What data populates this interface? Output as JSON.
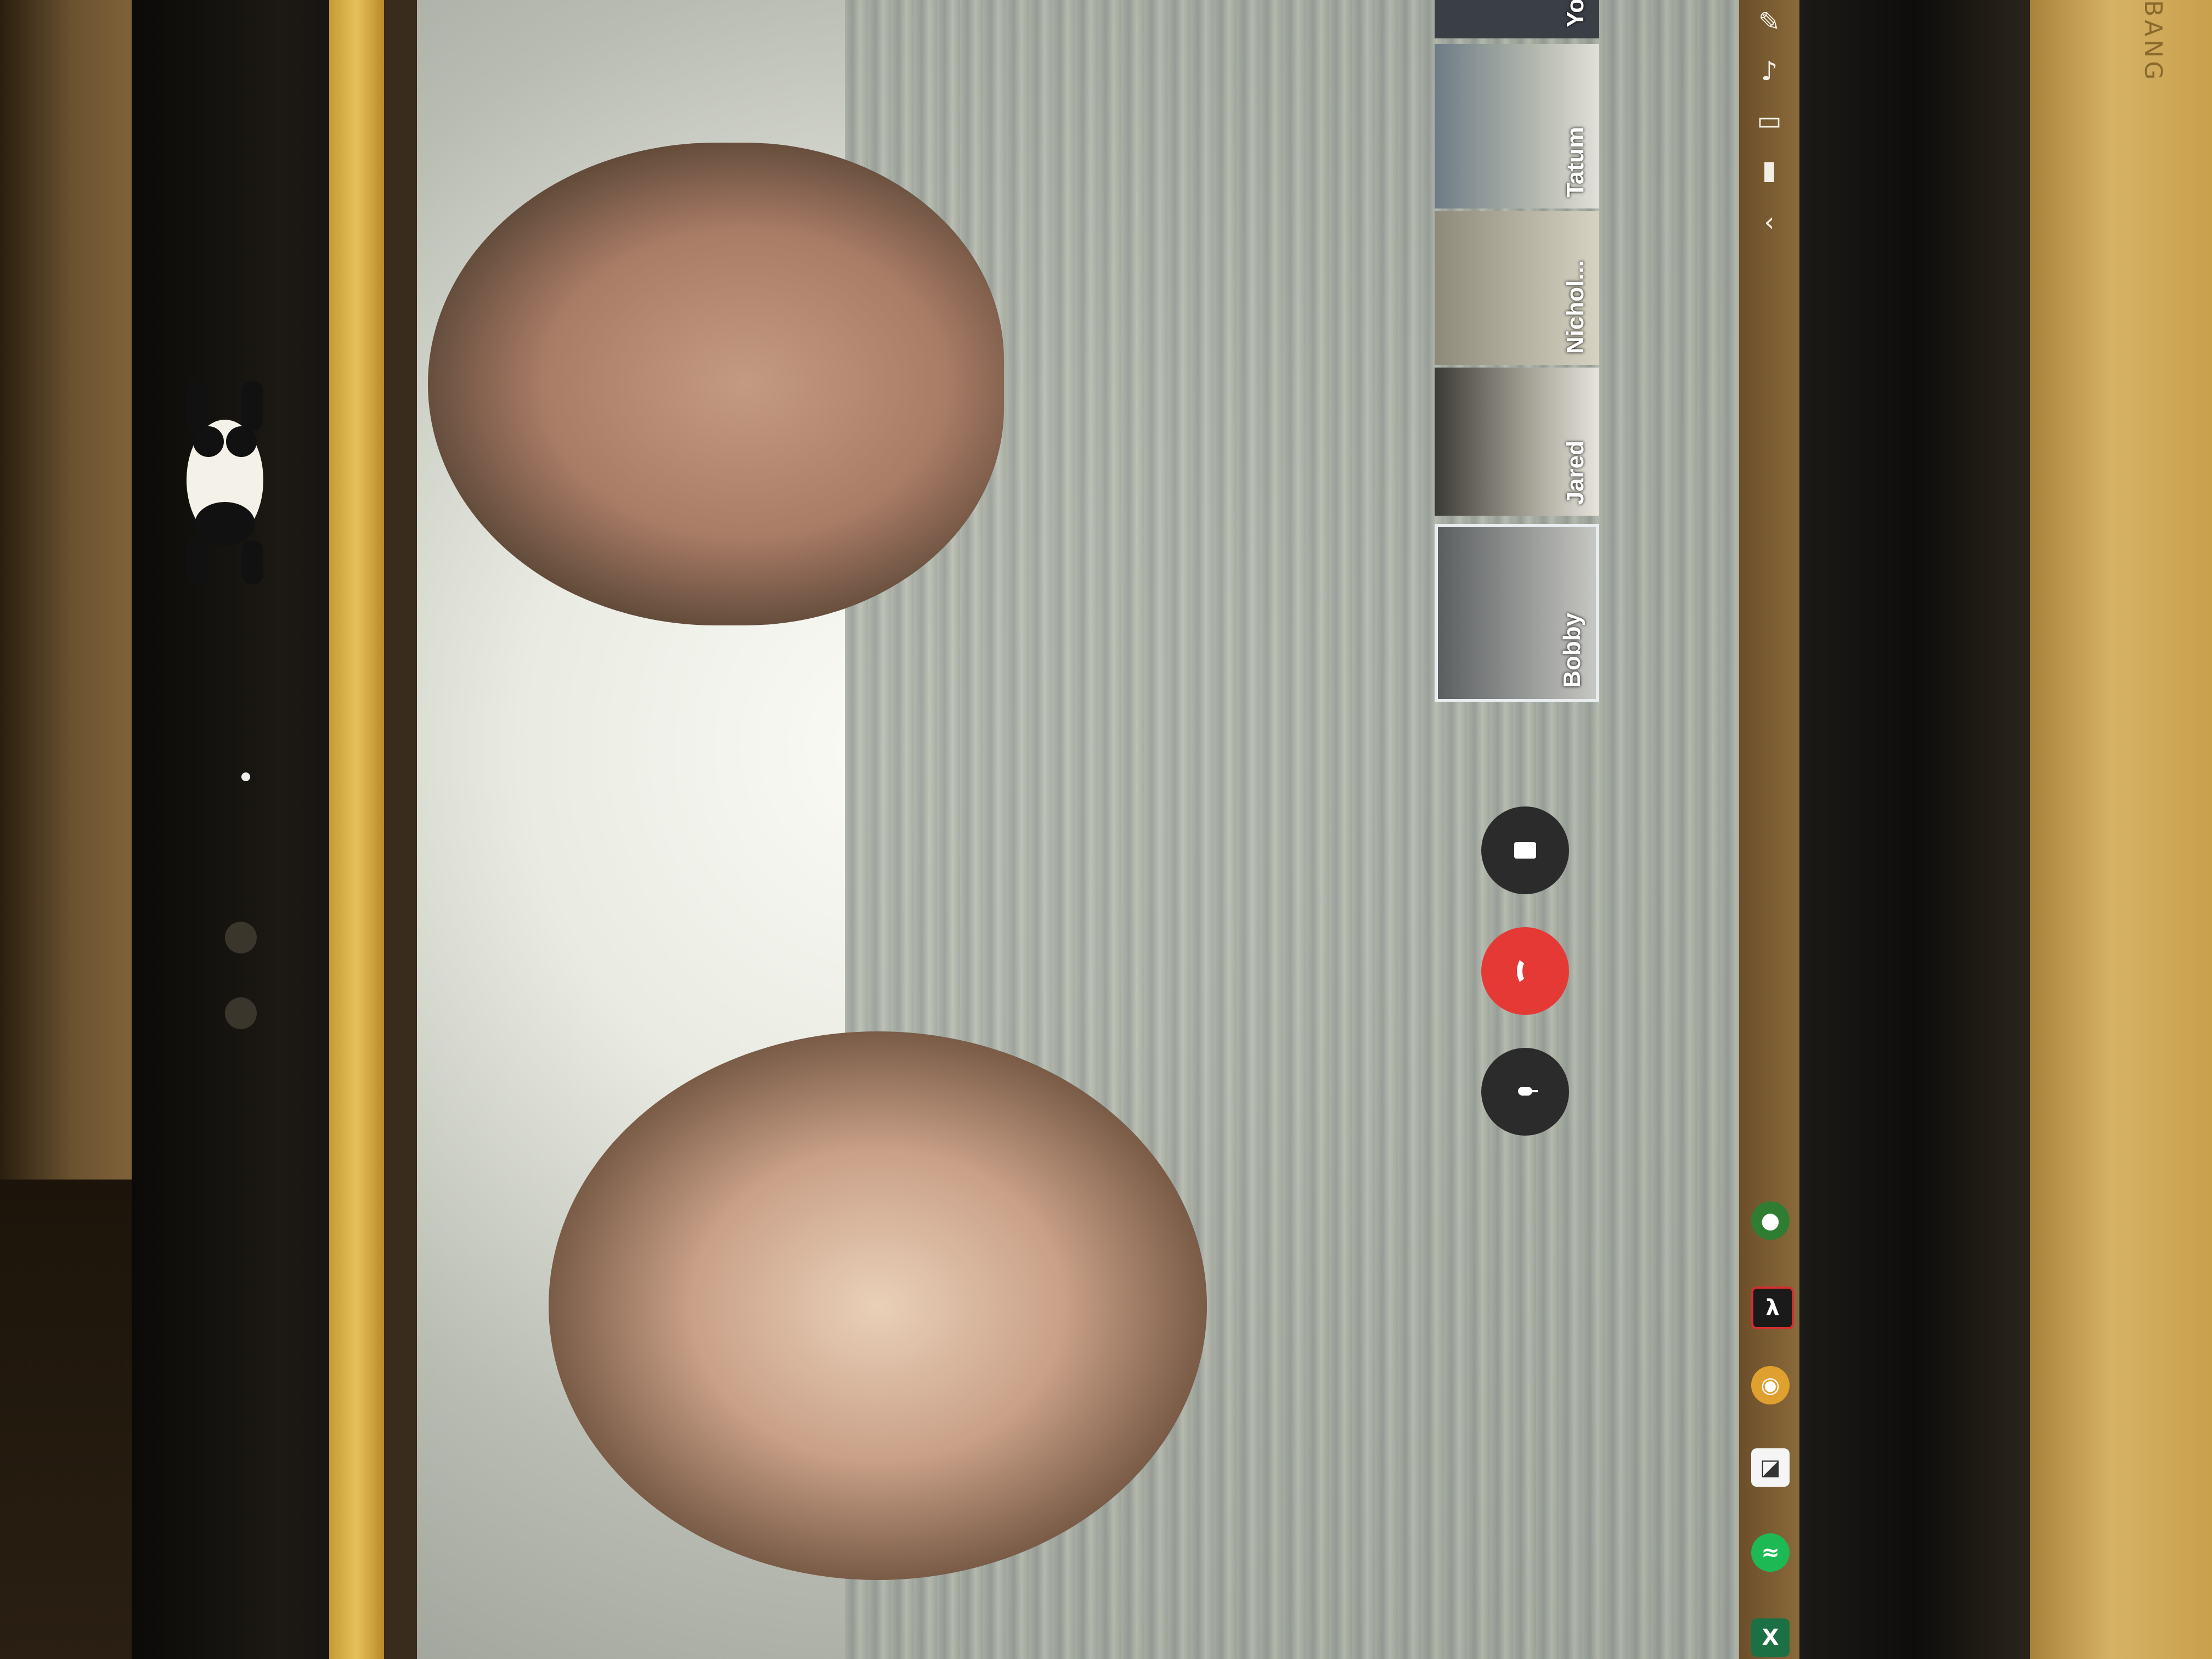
{
  "participants": [
    {
      "name": "You"
    },
    {
      "name": "Tatum"
    },
    {
      "name": "Nichol..."
    },
    {
      "name": "Jared"
    },
    {
      "name": "Bobby",
      "active": true
    }
  ],
  "controls": {
    "mic_icon": "microphone-icon",
    "end_icon": "phone-hangup-icon",
    "camera_icon": "camera-icon"
  },
  "colors": {
    "end_call": "#e53935",
    "control_dark": "#2b2b2b"
  },
  "taskbar": {
    "tray_icons": [
      "settings-icon",
      "volume-icon",
      "display-icon",
      "battery-icon",
      "chevron-up-icon"
    ],
    "apps": [
      "hangouts-app-icon",
      "acrobat-app-icon",
      "chrome-app-icon",
      "file-app-icon",
      "spotify-app-icon",
      "excel-app-icon"
    ]
  },
  "device_brand": "BANG"
}
